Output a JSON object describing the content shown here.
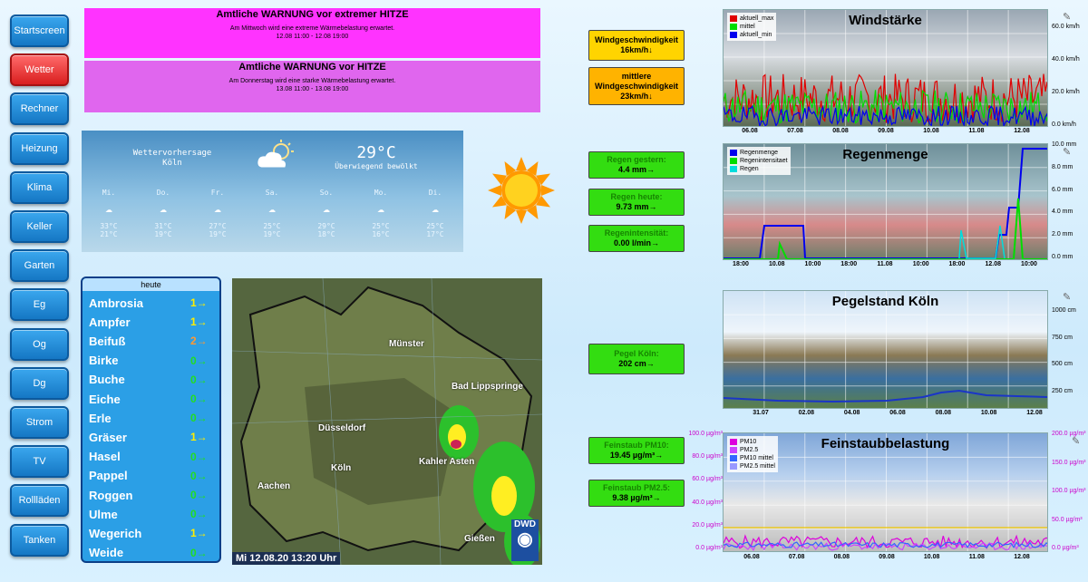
{
  "nav": [
    "Startscreen",
    "Wetter",
    "Rechner",
    "Heizung",
    "Klima",
    "Keller",
    "Garten",
    "Eg",
    "Og",
    "Dg",
    "Strom",
    "TV",
    "Rollläden",
    "Tanken"
  ],
  "nav_active": 1,
  "warnings": [
    {
      "title": "Amtliche WARNUNG vor extremer HITZE",
      "text": "Am Mittwoch wird eine extreme Wärmebelastung erwartet.",
      "period": "12.08 11:00 - 12.08 19:00",
      "color": "#ff33ff"
    },
    {
      "title": "Amtliche WARNUNG vor HITZE",
      "text": "Am Donnerstag wird eine starke Wärmebelastung erwartet.",
      "period": "13.08 11:00 - 13.08 19:00",
      "color": "#e066ee"
    }
  ],
  "forecast": {
    "title": "Wettervorhersage",
    "city": "Köln",
    "temp": "29°C",
    "desc": "Überwiegend bewölkt",
    "days": [
      {
        "d": "Mi.",
        "hi": "33°C",
        "lo": "21°C"
      },
      {
        "d": "Do.",
        "hi": "31°C",
        "lo": "19°C"
      },
      {
        "d": "Fr.",
        "hi": "27°C",
        "lo": "19°C"
      },
      {
        "d": "Sa.",
        "hi": "25°C",
        "lo": "19°C"
      },
      {
        "d": "So.",
        "hi": "29°C",
        "lo": "18°C"
      },
      {
        "d": "Mo.",
        "hi": "25°C",
        "lo": "16°C"
      },
      {
        "d": "Di.",
        "hi": "25°C",
        "lo": "17°C"
      }
    ]
  },
  "values": {
    "wind_label": "Windgeschwindigkeit",
    "wind_val": "16km/h↓",
    "wind_avg_label": "mittlere Windgeschwindigkeit",
    "wind_avg_val": "23km/h↓",
    "rain_yest_label": "Regen gestern:",
    "rain_yest_val": "4.4 mm→",
    "rain_today_label": "Regen heute:",
    "rain_today_val": "9.73 mm→",
    "rain_int_label": "Regenintensität:",
    "rain_int_val": "0.00 l/min→",
    "pegel_label": "Pegel Köln:",
    "pegel_val": "202 cm→",
    "pm10_label": "Feinstaub PM10:",
    "pm10_val": "19.45 µg/m³→",
    "pm25_label": "Feinstaub PM2.5:",
    "pm25_val": "9.38 µg/m³→"
  },
  "pollen": {
    "header": "heute",
    "items": [
      {
        "name": "Ambrosia",
        "level": "1→",
        "color": "#ffee00"
      },
      {
        "name": "Ampfer",
        "level": "1→",
        "color": "#ffee00"
      },
      {
        "name": "Beifuß",
        "level": "2→",
        "color": "#ff9933"
      },
      {
        "name": "Birke",
        "level": "0→",
        "color": "#22dd22"
      },
      {
        "name": "Buche",
        "level": "0→",
        "color": "#22dd22"
      },
      {
        "name": "Eiche",
        "level": "0→",
        "color": "#22dd22"
      },
      {
        "name": "Erle",
        "level": "0→",
        "color": "#22dd22"
      },
      {
        "name": "Gräser",
        "level": "1→",
        "color": "#ffee00"
      },
      {
        "name": "Hasel",
        "level": "0→",
        "color": "#22dd22"
      },
      {
        "name": "Pappel",
        "level": "0→",
        "color": "#22dd22"
      },
      {
        "name": "Roggen",
        "level": "0→",
        "color": "#22dd22"
      },
      {
        "name": "Ulme",
        "level": "0→",
        "color": "#22dd22"
      },
      {
        "name": "Wegerich",
        "level": "1→",
        "color": "#ffee00"
      },
      {
        "name": "Weide",
        "level": "0→",
        "color": "#22dd22"
      }
    ]
  },
  "map": {
    "cities": [
      "Münster",
      "Bad Lippspringe",
      "Düsseldorf",
      "Kahler Asten",
      "Köln",
      "Aachen",
      "Gießen"
    ],
    "timestamp": "Mi 12.08.20  13:20 Uhr",
    "logo": "DWD"
  },
  "charts": {
    "wind": {
      "title": "Windstärke",
      "legend": [
        "aktuell_max",
        "mittel",
        "aktuell_min"
      ],
      "colors": [
        "#e00000",
        "#00dd00",
        "#0000ee"
      ],
      "xticks": [
        "06.08",
        "07.08",
        "08.08",
        "09.08",
        "10.08",
        "11.08",
        "12.08"
      ],
      "yticks": [
        "60.0 km/h",
        "40.0 km/h",
        "20.0 km/h",
        "0.0 km/h"
      ]
    },
    "rain": {
      "title": "Regenmenge",
      "legend": [
        "Regenmenge",
        "Regenintensitaet",
        "Regen"
      ],
      "colors": [
        "#0000ee",
        "#00dd00",
        "#00dddd"
      ],
      "xticks": [
        "18:00",
        "10.08",
        "10:00",
        "18:00",
        "11.08",
        "10:00",
        "18:00",
        "12.08",
        "10:00"
      ],
      "yticks": [
        "10.0 mm",
        "8.0 mm",
        "6.0 mm",
        "4.0 mm",
        "2.0 mm",
        "0.0 mm"
      ]
    },
    "pegel": {
      "title": "Pegelstand Köln",
      "xticks": [
        "31.07",
        "02.08",
        "04.08",
        "06.08",
        "08.08",
        "10.08",
        "12.08"
      ],
      "yticks": [
        "1000 cm",
        "750 cm",
        "500 cm",
        "250 cm"
      ]
    },
    "dust": {
      "title": "Feinstaubbelastung",
      "legend": [
        "PM10",
        "PM2.5",
        "PM10 mittel",
        "PM2.5 mittel"
      ],
      "colors": [
        "#dd00dd",
        "#cc44ff",
        "#3366ff",
        "#9999ff"
      ],
      "xticks": [
        "06.08",
        "07.08",
        "08.08",
        "09.08",
        "10.08",
        "11.08",
        "12.08"
      ],
      "yticks_left": [
        "100.0 µg/m³",
        "80.0 µg/m³",
        "60.0 µg/m³",
        "40.0 µg/m³",
        "20.0 µg/m³",
        "0.0 µg/m³"
      ],
      "yticks_right": [
        "200.0 µg/m³",
        "150.0 µg/m³",
        "100.0 µg/m³",
        "50.0 µg/m³",
        "0.0 µg/m³"
      ]
    }
  }
}
